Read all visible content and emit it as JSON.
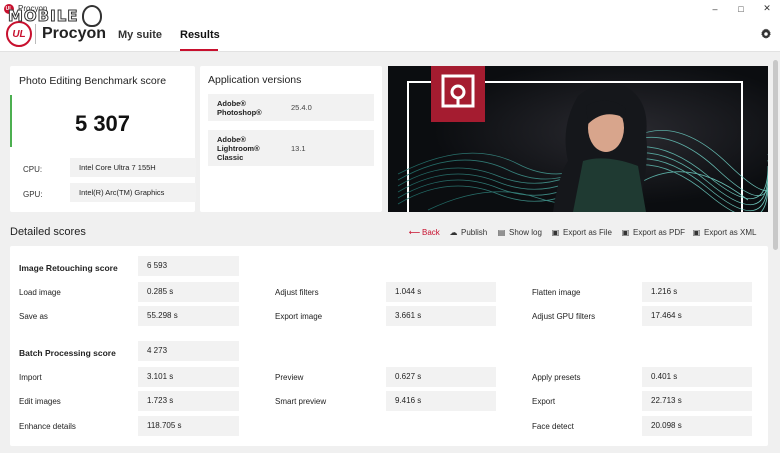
{
  "window": {
    "title": "Procyon",
    "minimize": "–",
    "maximize": "□",
    "close": "✕"
  },
  "watermark": {
    "text": "MOBILE"
  },
  "header": {
    "logo_text": "UL",
    "brand": "Procyon",
    "tabs": [
      {
        "label": "My suite"
      },
      {
        "label": "Results"
      }
    ],
    "active_tab": "Results"
  },
  "score_card": {
    "title": "Photo Editing Benchmark score",
    "score": "5 307",
    "cpu_label": "CPU:",
    "cpu_value": "Intel Core Ultra 7 155H",
    "gpu_label": "GPU:",
    "gpu_value": "Intel(R) Arc(TM) Graphics"
  },
  "versions": {
    "title": "Application versions",
    "apps": [
      {
        "name_lines": [
          "Adobe®",
          "Photoshop®"
        ],
        "version": "25.4.0"
      },
      {
        "name_lines": [
          "Adobe®",
          "Lightroom®",
          "Classic"
        ],
        "version": "13.1"
      }
    ]
  },
  "detailed": {
    "title": "Detailed scores",
    "toolbar": [
      {
        "label": "Back",
        "icon": "back-arrow-icon"
      },
      {
        "label": "Publish",
        "icon": "cloud-upload-icon"
      },
      {
        "label": "Show log",
        "icon": "document-icon"
      },
      {
        "label": "Export as File",
        "icon": "save-icon"
      },
      {
        "label": "Export as PDF",
        "icon": "save-icon"
      },
      {
        "label": "Export as XML",
        "icon": "save-icon"
      }
    ],
    "image_retouching": {
      "label": "Image Retouching score",
      "value": "6 593",
      "metrics": [
        {
          "label": "Load image",
          "value": "0.285 s"
        },
        {
          "label": "Adjust filters",
          "value": "1.044 s"
        },
        {
          "label": "Flatten image",
          "value": "1.216 s"
        },
        {
          "label": "Save as",
          "value": "55.298 s"
        },
        {
          "label": "Export image",
          "value": "3.661 s"
        },
        {
          "label": "Adjust GPU filters",
          "value": "17.464 s"
        }
      ]
    },
    "batch_processing": {
      "label": "Batch Processing score",
      "value": "4 273",
      "metrics": [
        {
          "label": "Import",
          "value": "3.101 s"
        },
        {
          "label": "Preview",
          "value": "0.627 s"
        },
        {
          "label": "Apply presets",
          "value": "0.401 s"
        },
        {
          "label": "Edit images",
          "value": "1.723 s"
        },
        {
          "label": "Smart preview",
          "value": "9.416 s"
        },
        {
          "label": "Export",
          "value": "22.713 s"
        },
        {
          "label": "Enhance details",
          "value": "118.705 s"
        },
        {
          "label": "Face detect",
          "value": "20.098 s"
        }
      ]
    }
  },
  "colors": {
    "accent_red": "#c8102e",
    "score_green": "#4caf50",
    "value_bg": "#f2f2f2"
  }
}
